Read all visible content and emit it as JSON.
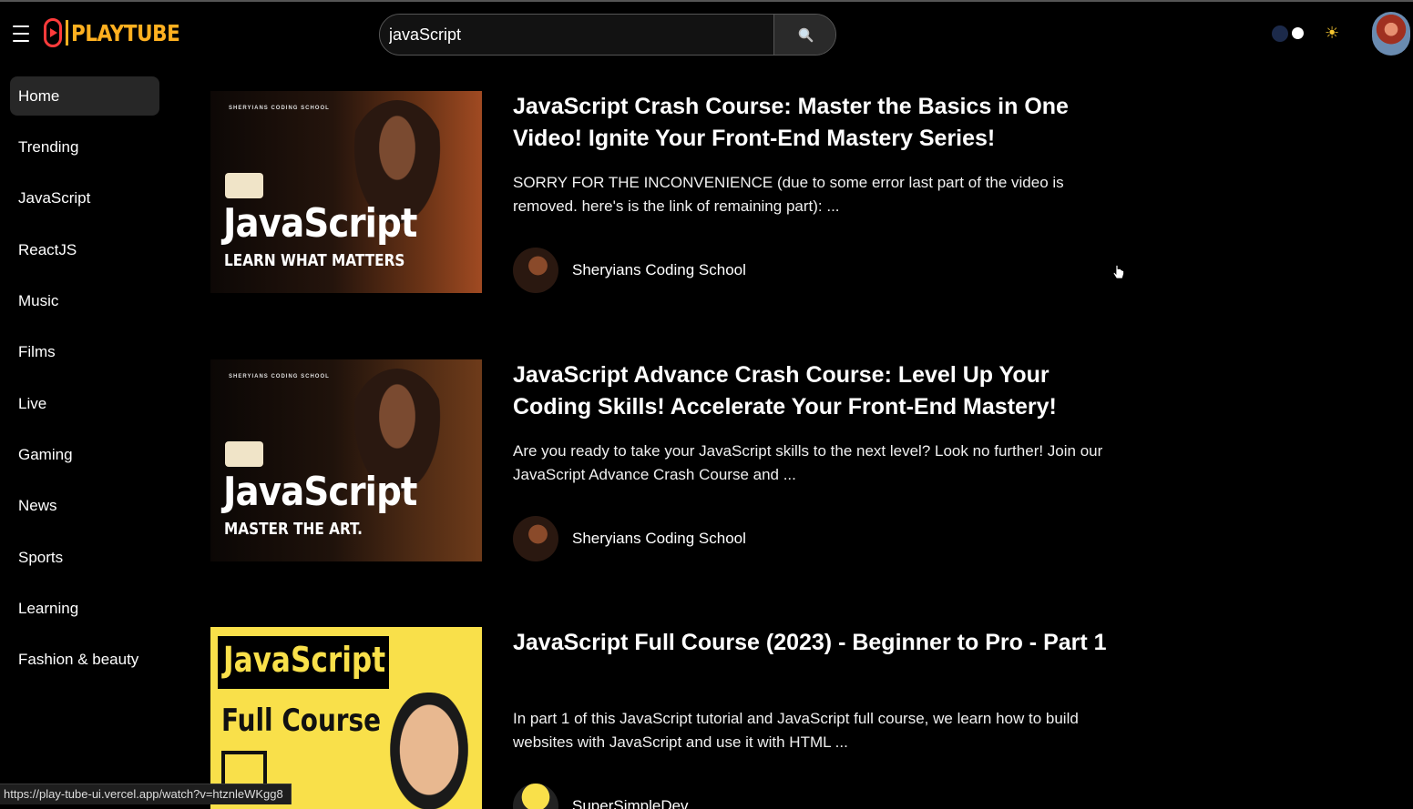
{
  "header": {
    "logo_text": "PLAYTUBE",
    "search_value": "javaScript"
  },
  "sidebar": {
    "items": [
      {
        "label": "Home",
        "active": true
      },
      {
        "label": "Trending"
      },
      {
        "label": "JavaScript"
      },
      {
        "label": "ReactJS"
      },
      {
        "label": "Music"
      },
      {
        "label": "Films"
      },
      {
        "label": "Live"
      },
      {
        "label": "Gaming"
      },
      {
        "label": "News"
      },
      {
        "label": "Sports"
      },
      {
        "label": "Learning"
      },
      {
        "label": "Fashion & beauty"
      }
    ]
  },
  "videos": [
    {
      "title": "JavaScript Crash Course: Master the Basics in One Video! Ignite Your Front-End Mastery Series!",
      "description": "SORRY FOR THE INCONVENIENCE (due to some error last part of the video is removed. here's is the link of remaining part): ...",
      "channel": "Sheryians Coding School",
      "thumb_school": "SHERYIANS CODING SCHOOL",
      "thumb_title": "JavaScript",
      "thumb_subtitle": "LEARN WHAT MATTERS"
    },
    {
      "title": "JavaScript Advance Crash Course: Level Up Your Coding Skills! Accelerate Your Front-End Mastery!",
      "description": "Are you ready to take your JavaScript skills to the next level? Look no further! Join our JavaScript Advance Crash Course and ...",
      "channel": "Sheryians Coding School",
      "thumb_school": "SHERYIANS CODING SCHOOL",
      "thumb_title": "JavaScript",
      "thumb_subtitle": "MASTER THE ART."
    },
    {
      "title": "JavaScript Full Course (2023) - Beginner to Pro - Part 1",
      "description": "In part 1 of this JavaScript tutorial and JavaScript full course, we learn how to build websites with JavaScript and use it with HTML ...",
      "channel": "SuperSimpleDev",
      "thumb_title": "JavaScript",
      "thumb_subtitle": "Full Course"
    }
  ],
  "status_bar": {
    "url": "https://play-tube-ui.vercel.app/watch?v=htznleWKgg8"
  },
  "colors": {
    "logo_red": "#ff3b3b",
    "logo_yellow": "#ffb020",
    "active_bg": "#272727",
    "sun": "#f4c430"
  }
}
